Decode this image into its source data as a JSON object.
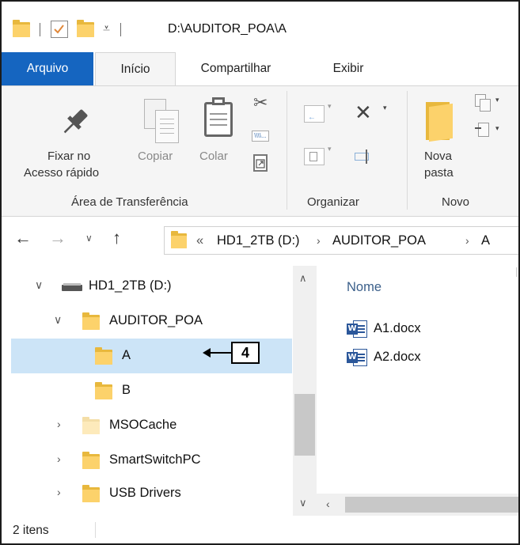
{
  "window": {
    "title_path": "D:\\AUDITOR_POA\\A"
  },
  "ribbon_tabs": [
    {
      "label": "Arquivo"
    },
    {
      "label": "Início"
    },
    {
      "label": "Compartilhar"
    },
    {
      "label": "Exibir"
    }
  ],
  "ribbon": {
    "clipboard": {
      "pin_label_1": "Fixar no",
      "pin_label_2": "Acesso rápido",
      "copy_label": "Copiar",
      "paste_label": "Colar",
      "group_label": "Área de Transferência"
    },
    "organize": {
      "group_label": "Organizar"
    },
    "new": {
      "folder_label_1": "Nova",
      "folder_label_2": "pasta",
      "group_label": "Novo"
    }
  },
  "address": {
    "overflow": "«",
    "crumbs": [
      "HD1_2TB (D:)",
      "AUDITOR_POA",
      "A"
    ]
  },
  "nav_tree": [
    {
      "label": "HD1_2TB (D:)",
      "icon": "drive-icon",
      "expander": "expanded"
    },
    {
      "label": "AUDITOR_POA",
      "icon": "folder-icon",
      "expander": "expanded"
    },
    {
      "label": "A",
      "icon": "folder-icon",
      "expander": "none",
      "selected": true
    },
    {
      "label": "B",
      "icon": "folder-icon",
      "expander": "none"
    },
    {
      "label": "MSOCache",
      "icon": "folder-icon",
      "expander": "collapsed"
    },
    {
      "label": "SmartSwitchPC",
      "icon": "folder-icon",
      "expander": "collapsed"
    },
    {
      "label": "USB Drivers",
      "icon": "folder-icon",
      "expander": "collapsed"
    }
  ],
  "annotation": {
    "callout_number": "4"
  },
  "content": {
    "column_header": "Nome",
    "files": [
      {
        "name": "A1.docx",
        "icon": "word-doc-icon"
      },
      {
        "name": "A2.docx",
        "icon": "word-doc-icon"
      }
    ]
  },
  "status": {
    "item_count": "2 itens"
  },
  "colors": {
    "accent": "#1565c0",
    "selection": "#cce4f7",
    "folder": "#fcd26b",
    "word": "#2b579a"
  }
}
